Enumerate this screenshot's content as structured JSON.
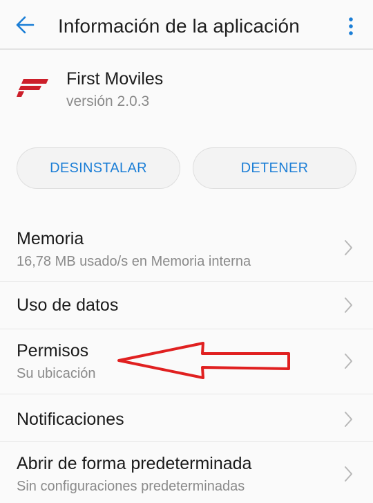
{
  "appbar": {
    "back_icon": "arrow-left-icon",
    "title": "Información de la aplicación",
    "more_icon": "more-vert-icon",
    "accent_color": "#1b7ed6"
  },
  "app": {
    "name": "First Moviles",
    "version": "versión 2.0.3",
    "logo_icon": "first-moviles-logo",
    "logo_color": "#cc1f2a"
  },
  "actions": {
    "uninstall_label": "DESINSTALAR",
    "stop_label": "DETENER"
  },
  "settings": {
    "memory": {
      "title": "Memoria",
      "subtitle": "16,78 MB usado/s en Memoria interna"
    },
    "data_usage": {
      "title": "Uso de datos"
    },
    "permissions": {
      "title": "Permisos",
      "subtitle": "Su ubicación"
    },
    "notifications": {
      "title": "Notificaciones"
    },
    "open_by_default": {
      "title": "Abrir de forma predeterminada",
      "subtitle": "Sin configuraciones predeterminadas"
    }
  },
  "annotation": {
    "arrow_color": "#e02020",
    "icon": "red-arrow-annotation"
  }
}
